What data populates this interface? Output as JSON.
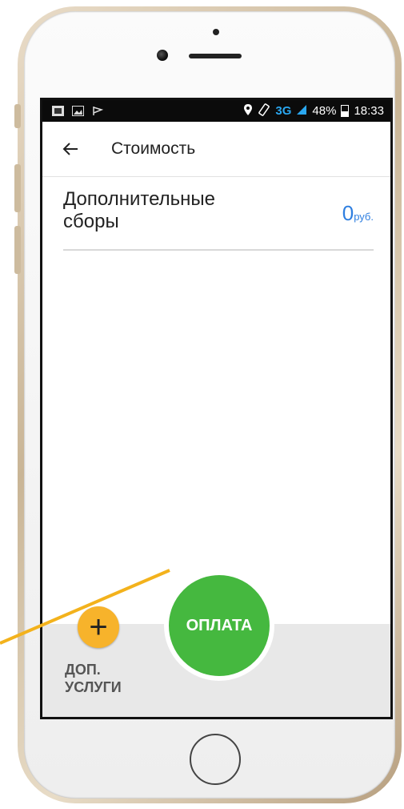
{
  "statusbar": {
    "network": "3G",
    "battery": "48%",
    "time": "18:33"
  },
  "appbar": {
    "title": "Стоимость",
    "back_icon": "arrow-left-icon"
  },
  "fee_row": {
    "label": "Дополнительные сборы",
    "value": "0",
    "unit": "руб."
  },
  "bottom": {
    "extra_services_label": "ДОП. УСЛУГИ",
    "pay_label": "ОПЛАТА"
  },
  "colors": {
    "pay_button": "#45b83f",
    "add_button": "#f7b32b",
    "value_text": "#2f7fe0",
    "pointer": "#f3b21c"
  }
}
